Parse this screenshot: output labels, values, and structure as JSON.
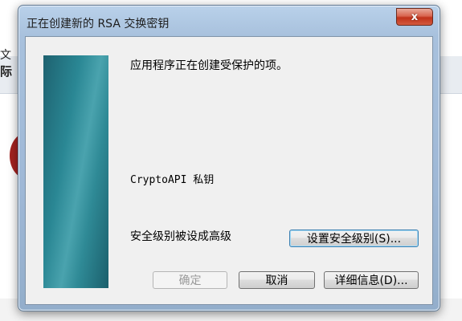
{
  "background": {
    "fragment_a": "文",
    "fragment_b": "际"
  },
  "dialog": {
    "title": "正在创建新的 RSA 交换密钥",
    "close_label": "x",
    "heading": "应用程序正在创建受保护的项。",
    "item_name": "CryptoAPI 私钥",
    "security_level_text": "安全级别被设成高级",
    "buttons": {
      "set_level": "设置安全级别(S)...",
      "ok": "确定",
      "cancel": "取消",
      "details": "详细信息(D)..."
    }
  },
  "colors": {
    "banner_teal": "#2a8794",
    "close_red": "#c0321a",
    "focus_blue": "#3c7fb1"
  }
}
